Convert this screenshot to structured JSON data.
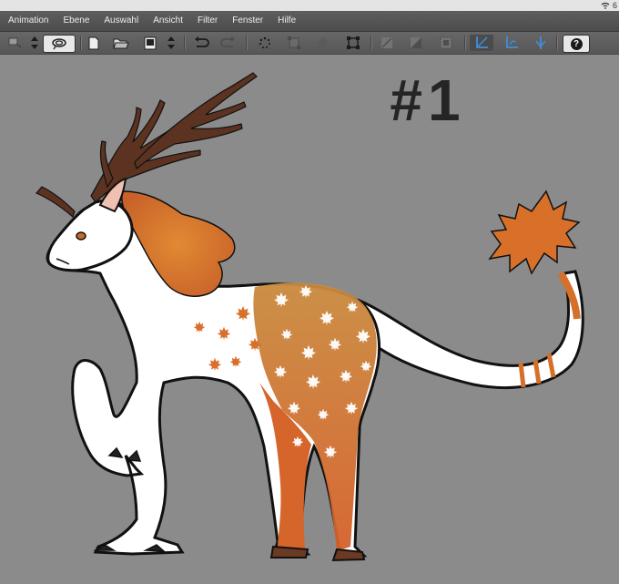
{
  "status": {
    "signal": "wifi-icon",
    "battery_partial": "6"
  },
  "menu": [
    "Animation",
    "Ebene",
    "Auswahl",
    "Ansicht",
    "Filter",
    "Fenster",
    "Hilfe"
  ],
  "help_label": "?",
  "canvas": {
    "heading": "#1",
    "background": "#8b8b8b",
    "colors": {
      "fur": "#ffffff",
      "antler": "#5b3320",
      "leaf": "#d8702a",
      "outline": "#111111"
    }
  }
}
